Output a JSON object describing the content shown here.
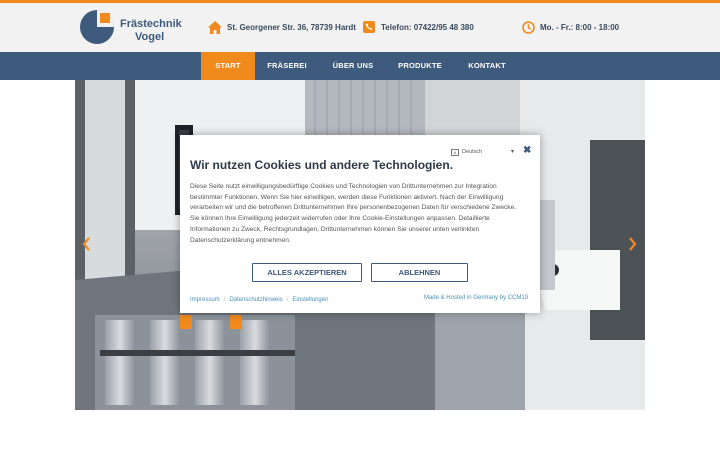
{
  "brand": {
    "name_line1": "Frästechnik",
    "name_line2": "Vogel",
    "accent_color": "#f08a1c",
    "primary_color": "#3e5a7c"
  },
  "header": {
    "address": {
      "icon": "home-icon",
      "text": "St. Georgener Str. 36, 78739 Hardt"
    },
    "phone": {
      "icon": "phone-icon",
      "text": "Telefon: 07422/95 48 380"
    },
    "hours": {
      "icon": "clock-icon",
      "text": "Mo. - Fr.: 8:00 - 18:00"
    }
  },
  "nav": {
    "items": [
      {
        "label": "START",
        "active": true
      },
      {
        "label": "FRÄSEREI",
        "active": false
      },
      {
        "label": "ÜBER UNS",
        "active": false
      },
      {
        "label": "PRODUKTE",
        "active": false
      },
      {
        "label": "KONTAKT",
        "active": false
      }
    ]
  },
  "slider": {
    "prev_icon": "chevron-left-icon",
    "next_icon": "chevron-right-icon"
  },
  "cookie_dialog": {
    "language": "Deutsch",
    "title": "Wir nutzen Cookies und andere Technologien.",
    "text": "Diese Seite nutzt einwilligungsbedürftige Cookies und Technologien von Drittunternehmen zur Integration bestimmter Funktionen. Wenn Sie hier einwilligen, werden diese Funktionen aktiviert. Nach der Einwilligung verarbeiten wir und die betroffenen Drittunternehmen Ihre personenbezogenen Daten für verschiedene Zwecke. Sie können Ihre Einwilligung jederzeit widerrufen oder Ihre Cookie-Einstellungen anpassen. Detaillierte Informationen zu Zweck, Rechtsgrundlagen, Drittunternehmen können Sie unserer unten verlinkten Datenschutzerklärung entnehmen.",
    "accept_label": "ALLES AKZEPTIEREN",
    "decline_label": "ABLEHNEN",
    "links": [
      "Impressum",
      "Datenschutzhinweis",
      "Einstellungen"
    ],
    "hosted_by": "Made & Hosted in Germany by CCM19"
  }
}
